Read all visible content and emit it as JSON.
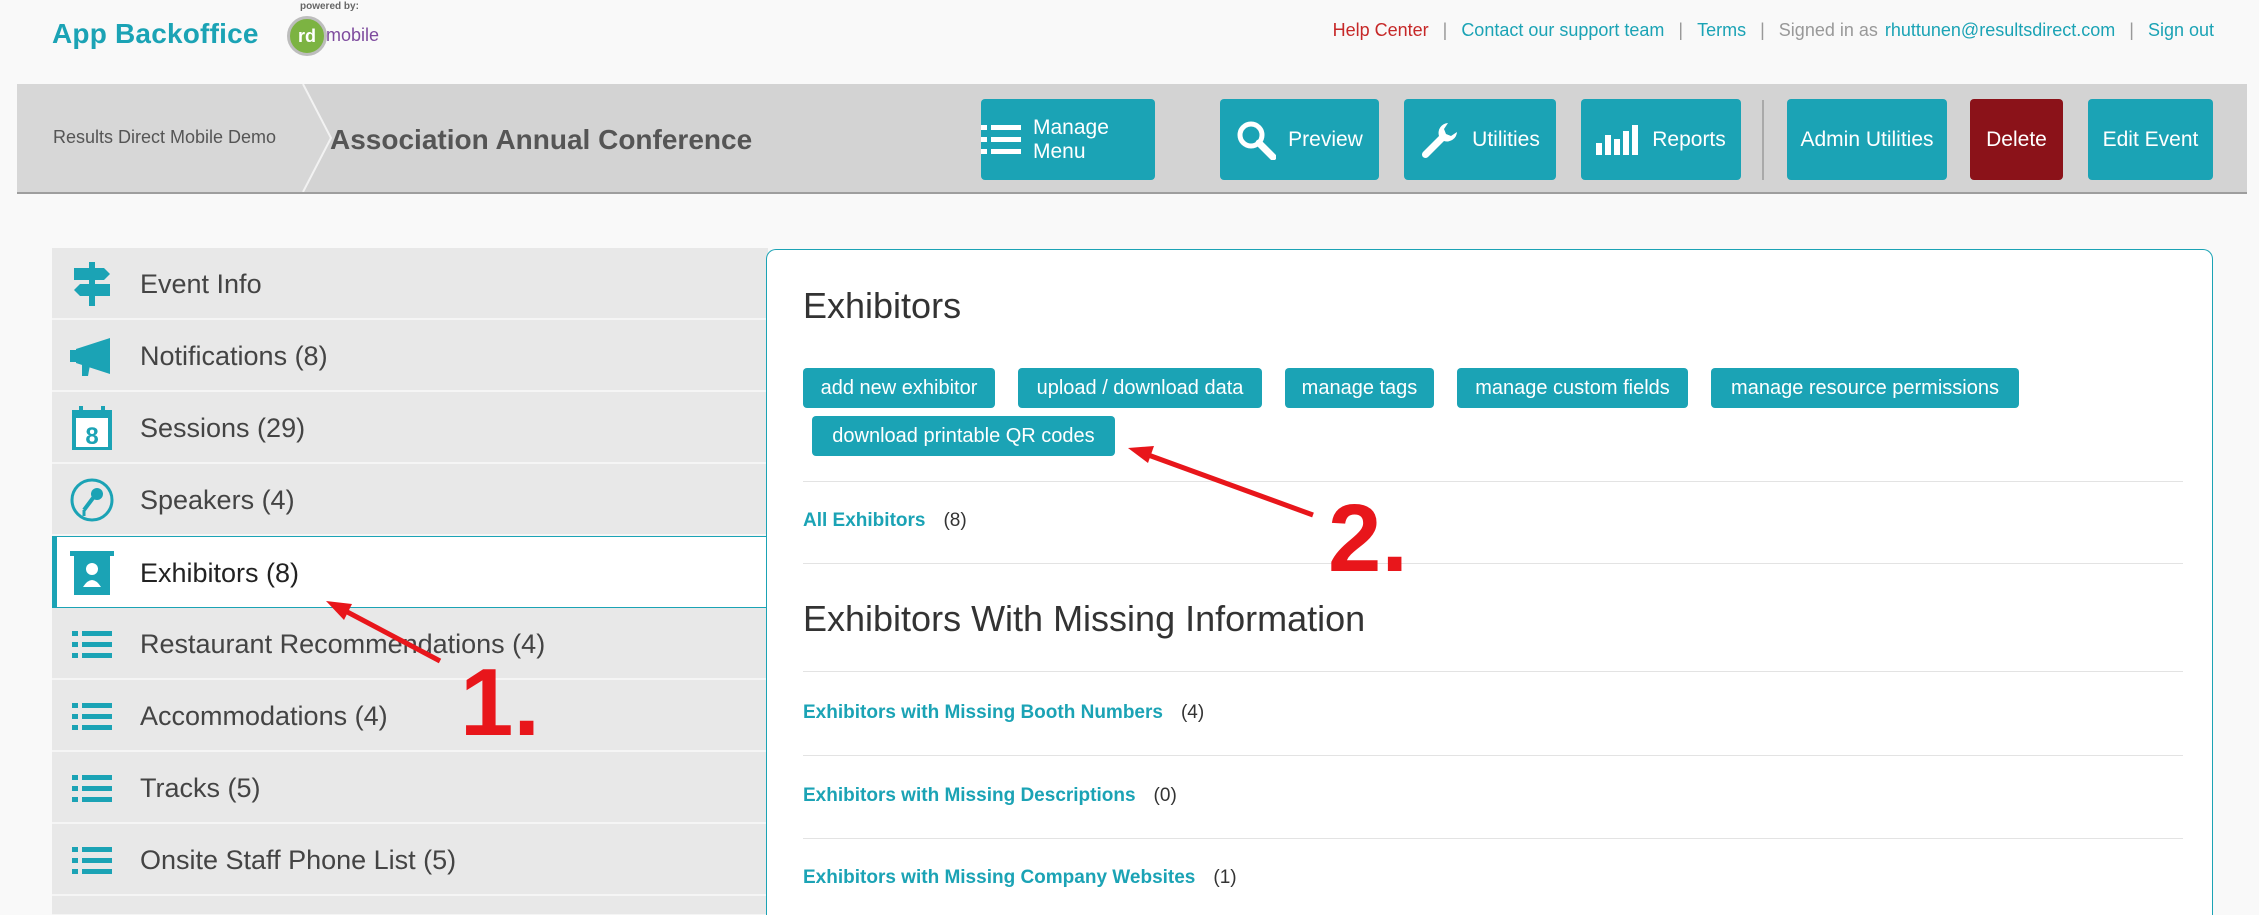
{
  "header": {
    "brand": "App Backoffice",
    "powered_by": "powered by:",
    "logo_rd": "rd",
    "logo_mobile": "mobile",
    "links": {
      "help": "Help Center",
      "contact": "Contact our support team",
      "terms": "Terms",
      "signed_in_prefix": "Signed in as",
      "user_email": "rhuttunen@resultsdirect.com",
      "sign_out": "Sign out"
    }
  },
  "event_bar": {
    "breadcrumb": "Results Direct Mobile Demo",
    "title": "Association Annual Conference",
    "buttons": {
      "manage_menu": "Manage Menu",
      "preview": "Preview",
      "utilities": "Utilities",
      "reports": "Reports",
      "admin_utilities": "Admin Utilities",
      "delete": "Delete",
      "edit_event": "Edit Event"
    }
  },
  "sidebar": {
    "items": [
      {
        "label": "Event Info",
        "icon": "signpost-icon"
      },
      {
        "label": "Notifications (8)",
        "icon": "megaphone-icon"
      },
      {
        "label": "Sessions (29)",
        "icon": "calendar-icon"
      },
      {
        "label": "Speakers (4)",
        "icon": "microphone-icon"
      },
      {
        "label": "Exhibitors (8)",
        "icon": "exhibitor-booth-icon",
        "active": true
      },
      {
        "label": "Restaurant Recommendations (4)",
        "icon": "list-icon"
      },
      {
        "label": "Accommodations (4)",
        "icon": "list-icon"
      },
      {
        "label": "Tracks (5)",
        "icon": "list-icon"
      },
      {
        "label": "Onsite Staff Phone List (5)",
        "icon": "list-icon"
      }
    ]
  },
  "main": {
    "title": "Exhibitors",
    "actions": {
      "add_new": "add new exhibitor",
      "upload_download": "upload / download data",
      "manage_tags": "manage tags",
      "manage_custom_fields": "manage custom fields",
      "manage_permissions": "manage resource permissions",
      "download_qr": "download printable QR codes"
    },
    "all_exhibitors": {
      "label": "All Exhibitors",
      "count": "(8)"
    },
    "missing_title": "Exhibitors With Missing Information",
    "missing": [
      {
        "label": "Exhibitors with Missing Booth Numbers",
        "count": "(4)"
      },
      {
        "label": "Exhibitors with Missing Descriptions",
        "count": "(0)"
      },
      {
        "label": "Exhibitors with Missing Company Websites",
        "count": "(1)"
      }
    ]
  },
  "annotations": {
    "step1": "1.",
    "step2": "2."
  },
  "colors": {
    "accent": "#1ba3b5",
    "danger": "#8b1219",
    "annotation": "#e8161b"
  }
}
